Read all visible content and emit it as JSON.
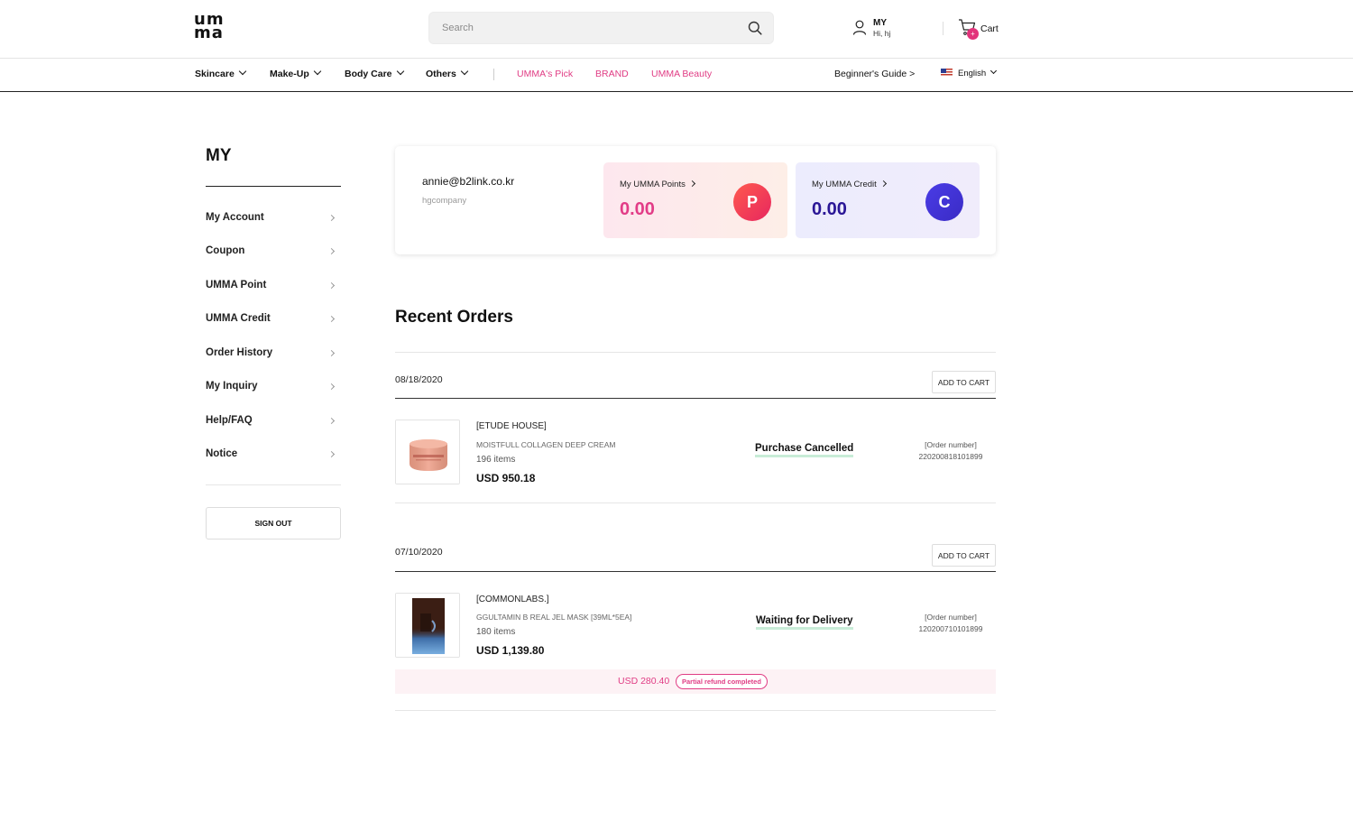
{
  "header": {
    "logo_line1": "um",
    "logo_line2": "ma",
    "search_placeholder": "Search",
    "my_label": "MY",
    "my_greeting": "Hi, hj",
    "cart_label": "Cart",
    "cart_count": "+"
  },
  "nav": {
    "categories": [
      {
        "label": "Skincare"
      },
      {
        "label": "Make-Up"
      },
      {
        "label": "Body Care"
      },
      {
        "label": "Others"
      }
    ],
    "highlights": [
      {
        "label": "UMMA's Pick"
      },
      {
        "label": "BRAND"
      },
      {
        "label": "UMMA Beauty"
      }
    ],
    "guide": "Beginner's Guide >",
    "language": "English"
  },
  "sidebar": {
    "title": "MY",
    "items": [
      {
        "label": "My Account"
      },
      {
        "label": "Coupon"
      },
      {
        "label": "UMMA Point"
      },
      {
        "label": "UMMA Credit"
      },
      {
        "label": "Order History"
      },
      {
        "label": "My Inquiry"
      },
      {
        "label": "Help/FAQ"
      },
      {
        "label": "Notice"
      }
    ],
    "signout": "SIGN OUT"
  },
  "account": {
    "email": "annie@b2link.co.kr",
    "company": "hgcompany",
    "points": {
      "label": "My UMMA Points",
      "value": "0.00",
      "badge": "P"
    },
    "credit": {
      "label": "My UMMA Credit",
      "value": "0.00",
      "badge": "C"
    }
  },
  "orders": {
    "title": "Recent Orders",
    "add_to_cart": "ADD TO CART",
    "order_number_label": "[Order number]",
    "list": [
      {
        "date": "08/18/2020",
        "brand": "[ETUDE HOUSE]",
        "product": "MOISTFULL COLLAGEN DEEP CREAM",
        "qty": "196 items",
        "price": "USD 950.18",
        "status": "Purchase Cancelled",
        "order_number": "220200818101899"
      },
      {
        "date": "07/10/2020",
        "brand": "[COMMONLABS.]",
        "product": "GGULTAMIN B REAL JEL MASK [39ML*5EA]",
        "qty": "180 items",
        "price": "USD 1,139.80",
        "status": "Waiting for Delivery",
        "order_number": "120200710101899",
        "refund_amount": "USD 280.40",
        "refund_status": "Partial refund completed"
      }
    ]
  },
  "colors": {
    "accent_pink": "#e03c84",
    "credit_purple": "#2a1696",
    "status_underline": "#c8ecd7"
  }
}
